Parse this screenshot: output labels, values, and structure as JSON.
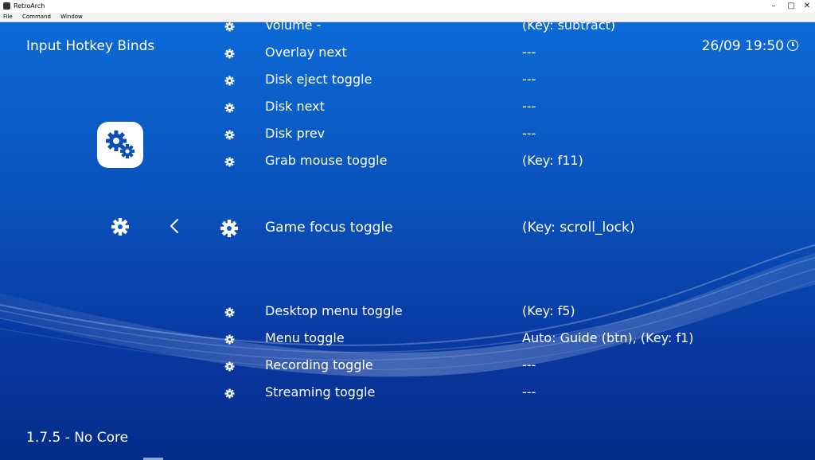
{
  "window": {
    "title": "RetroArch",
    "minimize": "–",
    "maximize": "□",
    "close": "✕"
  },
  "menubar": [
    "File",
    "Command",
    "Window"
  ],
  "header": {
    "title": "Input Hotkey Binds",
    "datetime": "26/09 19:50"
  },
  "footer": {
    "version": "1.7.5 - No Core"
  },
  "rows": [
    {
      "label": "Volume -",
      "value": "(Key: subtract)"
    },
    {
      "label": "Overlay next",
      "value": "---"
    },
    {
      "label": "Disk eject toggle",
      "value": "---"
    },
    {
      "label": "Disk next",
      "value": "---"
    },
    {
      "label": "Disk prev",
      "value": "---"
    },
    {
      "label": "Grab mouse toggle",
      "value": "(Key: f11)"
    },
    {
      "label": "Game focus toggle",
      "value": "(Key: scroll_lock)"
    },
    {
      "label": "Desktop menu toggle",
      "value": "(Key: f5)"
    },
    {
      "label": "Menu toggle",
      "value": "Auto: Guide (btn), (Key: f1)"
    },
    {
      "label": "Recording toggle",
      "value": "---"
    },
    {
      "label": "Streaming toggle",
      "value": "---"
    }
  ],
  "selected_index": 6,
  "icons": {
    "category": "settings-gears-icon",
    "row": "gear-icon",
    "back": "chevron-left-icon",
    "clock": "clock-icon"
  }
}
